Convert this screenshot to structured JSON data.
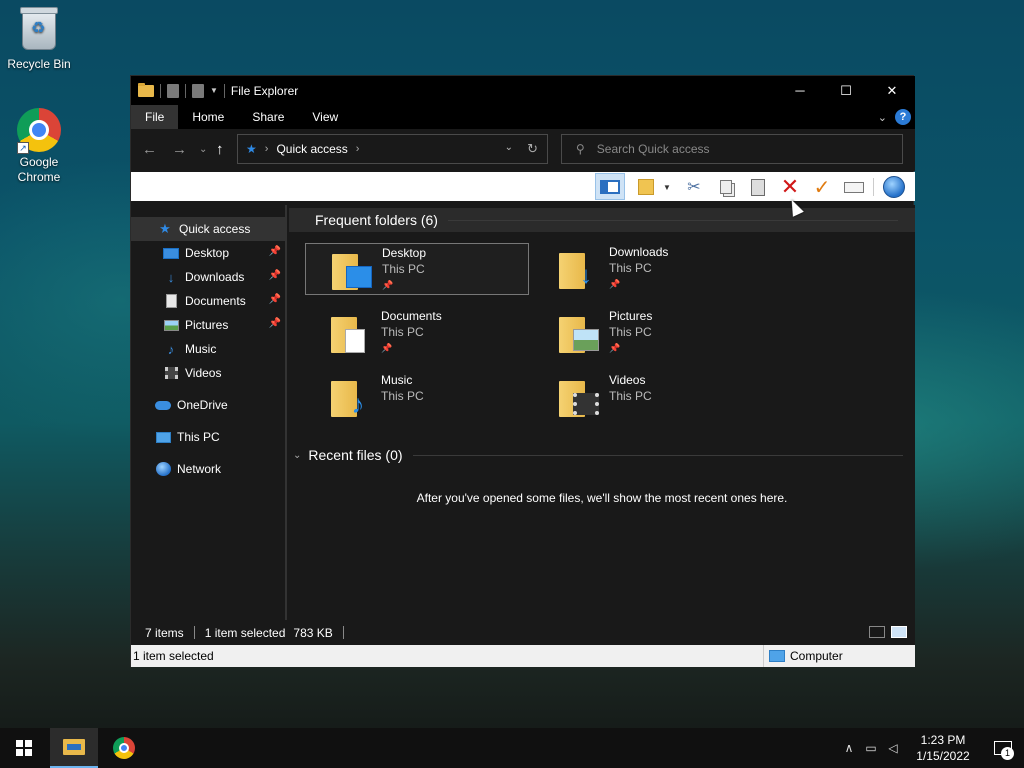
{
  "desktop": {
    "icons": [
      {
        "label": "Recycle Bin"
      },
      {
        "label": "Google\nChrome"
      }
    ]
  },
  "window": {
    "title": "File Explorer",
    "caption": {
      "minimize": "─",
      "maximize": "☐",
      "close": "✕"
    },
    "ribbon_tabs": [
      {
        "label": "File"
      },
      {
        "label": "Home"
      },
      {
        "label": "Share"
      },
      {
        "label": "View"
      }
    ],
    "address": {
      "crumb": "Quick access"
    },
    "search": {
      "placeholder": "Search Quick access"
    },
    "sidebar": [
      {
        "label": "Quick access",
        "icon": "star-icon"
      },
      {
        "label": "Desktop",
        "icon": "desktop-icon",
        "pinned": true
      },
      {
        "label": "Downloads",
        "icon": "download-icon",
        "pinned": true
      },
      {
        "label": "Documents",
        "icon": "document-icon",
        "pinned": true
      },
      {
        "label": "Pictures",
        "icon": "pictures-icon",
        "pinned": true
      },
      {
        "label": "Music",
        "icon": "music-icon"
      },
      {
        "label": "Videos",
        "icon": "videos-icon"
      },
      {
        "label": "OneDrive",
        "icon": "cloud-icon"
      },
      {
        "label": "This PC",
        "icon": "computer-icon"
      },
      {
        "label": "Network",
        "icon": "network-icon"
      }
    ],
    "frequent": {
      "header": "Frequent folders (6)",
      "folders": [
        {
          "name": "Desktop",
          "location": "This PC",
          "pinned": true
        },
        {
          "name": "Downloads",
          "location": "This PC",
          "pinned": true
        },
        {
          "name": "Documents",
          "location": "This PC",
          "pinned": true
        },
        {
          "name": "Pictures",
          "location": "This PC",
          "pinned": true
        },
        {
          "name": "Music",
          "location": "This PC"
        },
        {
          "name": "Videos",
          "location": "This PC"
        }
      ]
    },
    "recent": {
      "header": "Recent files (0)",
      "empty_message": "After you've opened some files, we'll show the most recent ones here."
    },
    "status": {
      "items": "7 items",
      "selected": "1 item selected",
      "size": "783 KB"
    },
    "bottom": {
      "left": "1 item selected",
      "zone": "Computer"
    }
  },
  "taskbar": {
    "time": "1:23 PM",
    "date": "1/15/2022",
    "notification_count": "1"
  },
  "colors": {
    "accent": "#2f8ae5",
    "delete": "#d01818",
    "window_bg": "#191919"
  }
}
